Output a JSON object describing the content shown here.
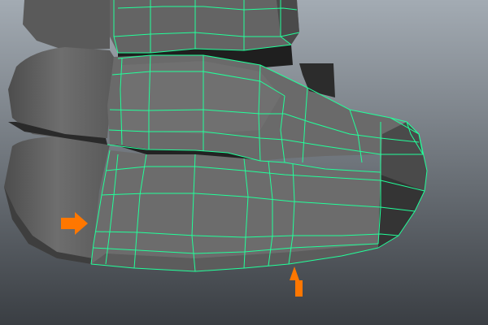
{
  "viewport": {
    "background_top": "#a3abb3",
    "background_bottom": "#3a3e43",
    "wireframe_color": "#22ff9a",
    "mesh_shade_light": "#777777",
    "mesh_shade_mid": "#656565",
    "mesh_shade_dark": "#484848",
    "mesh_shade_deep": "#2f2f2f",
    "annotation_color": "#ff7700"
  },
  "annotations": [
    {
      "name": "arrow-pointing-right",
      "direction": "right"
    },
    {
      "name": "arrow-pointing-up",
      "direction": "up"
    }
  ]
}
